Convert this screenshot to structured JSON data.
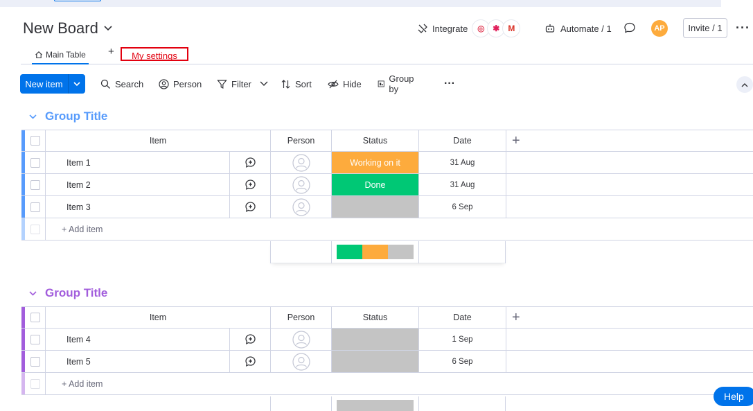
{
  "board": {
    "title": "New Board"
  },
  "header": {
    "integrate_label": "Integrate",
    "automate_label": "Automate / 1",
    "avatar_initials": "AP",
    "invite_label": "Invite / 1"
  },
  "tabs": {
    "main_label": "Main Table",
    "settings_label": "My settings"
  },
  "toolbar": {
    "new_item_label": "New item",
    "search_label": "Search",
    "person_label": "Person",
    "filter_label": "Filter",
    "sort_label": "Sort",
    "hide_label": "Hide",
    "group_by_label": "Group by"
  },
  "colors": {
    "accent": "#0073ea",
    "group1": "#579bfc",
    "group2": "#a25ddc",
    "status_working": "#fdab3d",
    "status_done": "#00c875",
    "status_empty": "#c4c4c4"
  },
  "columns": {
    "item": "Item",
    "person": "Person",
    "status": "Status",
    "date": "Date"
  },
  "groups": [
    {
      "title": "Group Title",
      "add_item_label": "+ Add item",
      "rows": [
        {
          "name": "Item 1",
          "status": "Working on it",
          "date": "31 Aug"
        },
        {
          "name": "Item 2",
          "status": "Done",
          "date": "31 Aug"
        },
        {
          "name": "Item 3",
          "status": "",
          "date": "6 Sep"
        }
      ],
      "status_summary": [
        {
          "label": "Done",
          "fraction": 0.333
        },
        {
          "label": "Working on it",
          "fraction": 0.333
        },
        {
          "label": "",
          "fraction": 0.334
        }
      ]
    },
    {
      "title": "Group Title",
      "add_item_label": "+ Add item",
      "rows": [
        {
          "name": "Item 4",
          "status": "",
          "date": "1 Sep"
        },
        {
          "name": "Item 5",
          "status": "",
          "date": "6 Sep"
        }
      ],
      "status_summary": [
        {
          "label": "",
          "fraction": 1.0
        }
      ]
    }
  ],
  "help_label": "Help"
}
